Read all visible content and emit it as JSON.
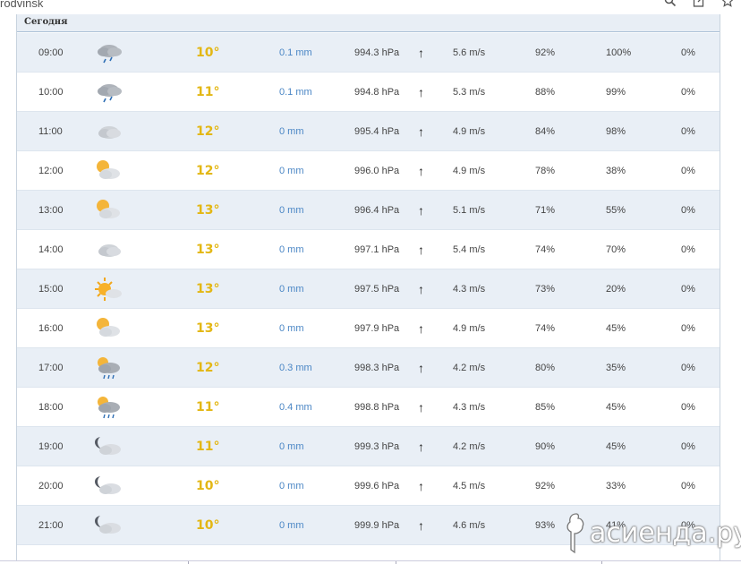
{
  "browser": {
    "address_fragment": "rodvinsk",
    "icons": [
      "search-icon",
      "share-icon",
      "star-icon"
    ]
  },
  "section": {
    "title": "Сегодня"
  },
  "rows": [
    {
      "time": "09:00",
      "icon": "cloud-rain",
      "temp": "10°",
      "precip": "0.1 mm",
      "pressure": "994.3 hPa",
      "wind_dir": "↑",
      "wind": "5.6 m/s",
      "humidity": "92%",
      "cloudiness": "100%",
      "precip_prob": "0%"
    },
    {
      "time": "10:00",
      "icon": "cloud-rain",
      "temp": "11°",
      "precip": "0.1 mm",
      "pressure": "994.8 hPa",
      "wind_dir": "↑",
      "wind": "5.3 m/s",
      "humidity": "88%",
      "cloudiness": "99%",
      "precip_prob": "0%"
    },
    {
      "time": "11:00",
      "icon": "cloud",
      "temp": "12°",
      "precip": "0 mm",
      "pressure": "995.4 hPa",
      "wind_dir": "↑",
      "wind": "4.9 m/s",
      "humidity": "84%",
      "cloudiness": "98%",
      "precip_prob": "0%"
    },
    {
      "time": "12:00",
      "icon": "sun-cloud",
      "temp": "12°",
      "precip": "0 mm",
      "pressure": "996.0 hPa",
      "wind_dir": "↑",
      "wind": "4.9 m/s",
      "humidity": "78%",
      "cloudiness": "38%",
      "precip_prob": "0%"
    },
    {
      "time": "13:00",
      "icon": "sun-cloud",
      "temp": "13°",
      "precip": "0 mm",
      "pressure": "996.4 hPa",
      "wind_dir": "↑",
      "wind": "5.1 m/s",
      "humidity": "71%",
      "cloudiness": "55%",
      "precip_prob": "0%"
    },
    {
      "time": "14:00",
      "icon": "cloud",
      "temp": "13°",
      "precip": "0 mm",
      "pressure": "997.1 hPa",
      "wind_dir": "↑",
      "wind": "5.4 m/s",
      "humidity": "74%",
      "cloudiness": "70%",
      "precip_prob": "0%"
    },
    {
      "time": "15:00",
      "icon": "sun-small-cloud",
      "temp": "13°",
      "precip": "0 mm",
      "pressure": "997.5 hPa",
      "wind_dir": "↑",
      "wind": "4.3 m/s",
      "humidity": "73%",
      "cloudiness": "20%",
      "precip_prob": "0%"
    },
    {
      "time": "16:00",
      "icon": "sun-cloud",
      "temp": "13°",
      "precip": "0 mm",
      "pressure": "997.9 hPa",
      "wind_dir": "↑",
      "wind": "4.9 m/s",
      "humidity": "74%",
      "cloudiness": "45%",
      "precip_prob": "0%"
    },
    {
      "time": "17:00",
      "icon": "sun-cloud-rain",
      "temp": "12°",
      "precip": "0.3 mm",
      "pressure": "998.3 hPa",
      "wind_dir": "↑",
      "wind": "4.2 m/s",
      "humidity": "80%",
      "cloudiness": "35%",
      "precip_prob": "0%"
    },
    {
      "time": "18:00",
      "icon": "sun-cloud-rain",
      "temp": "11°",
      "precip": "0.4 mm",
      "pressure": "998.8 hPa",
      "wind_dir": "↑",
      "wind": "4.3 m/s",
      "humidity": "85%",
      "cloudiness": "45%",
      "precip_prob": "0%"
    },
    {
      "time": "19:00",
      "icon": "moon-cloud",
      "temp": "11°",
      "precip": "0 mm",
      "pressure": "999.3 hPa",
      "wind_dir": "↑",
      "wind": "4.2 m/s",
      "humidity": "90%",
      "cloudiness": "45%",
      "precip_prob": "0%"
    },
    {
      "time": "20:00",
      "icon": "moon-cloud",
      "temp": "10°",
      "precip": "0 mm",
      "pressure": "999.6 hPa",
      "wind_dir": "↑",
      "wind": "4.5 m/s",
      "humidity": "92%",
      "cloudiness": "33%",
      "precip_prob": "0%"
    },
    {
      "time": "21:00",
      "icon": "moon-cloud",
      "temp": "10°",
      "precip": "0 mm",
      "pressure": "999.9 hPa",
      "wind_dir": "↑",
      "wind": "4.6 m/s",
      "humidity": "93%",
      "cloudiness": "41%",
      "precip_prob": "0%"
    }
  ],
  "watermark": {
    "text": "асиенда.ру"
  },
  "colors": {
    "temp": "#e3b714",
    "precip": "#4a86c5",
    "row_alt": "#e9eff6",
    "header_bg": "#e8eef5"
  }
}
